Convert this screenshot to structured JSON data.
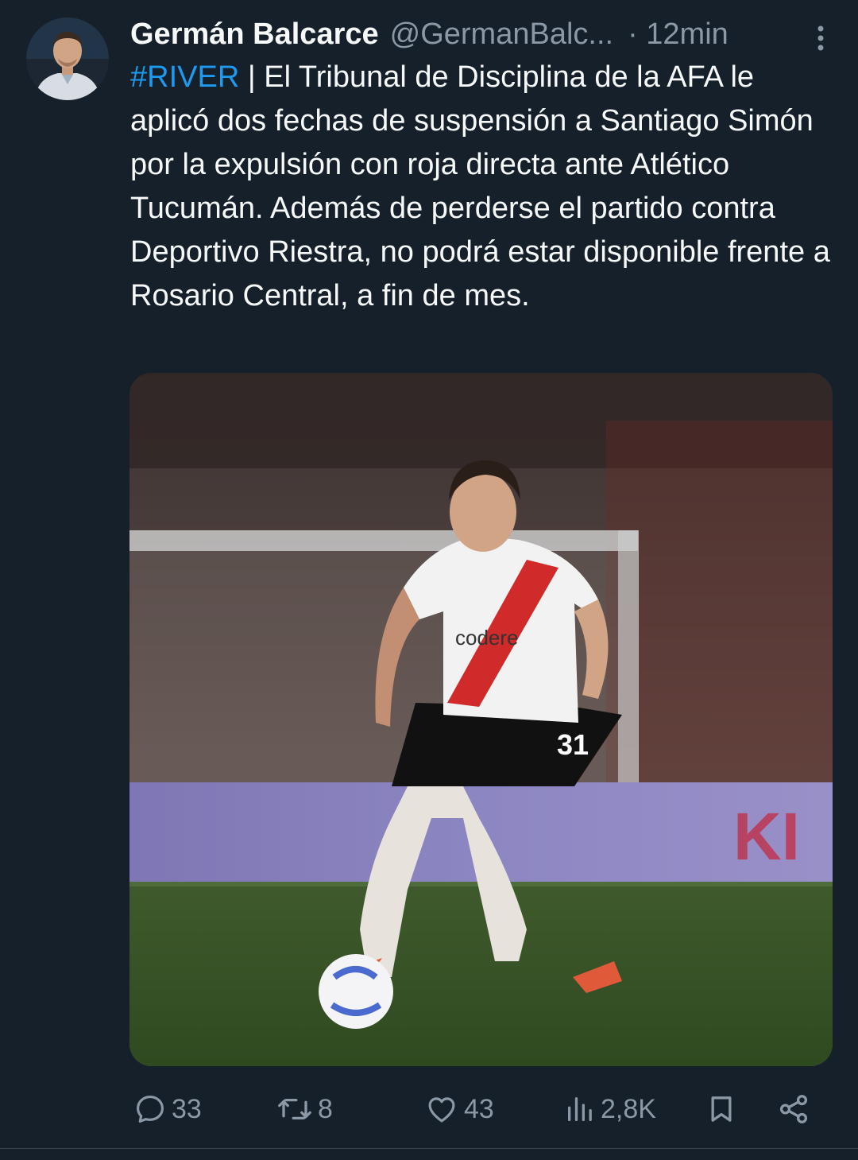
{
  "author": {
    "display_name": "Germán Balcarce",
    "handle": "@GermanBalc...",
    "time": "· 12min"
  },
  "tweet": {
    "hashtag": "#RIVER",
    "body": " | El Tribunal de Disciplina de la AFA le aplicó dos fechas de suspensión a Santiago Simón por la expulsión con roja directa ante Atlético Tucumán. Además de perderse el partido contra Deportivo Riestra, no podrá estar disponible frente a Rosario Central, a fin de mes."
  },
  "media": {
    "jersey_sponsor": "codere",
    "jersey_number": "31",
    "board_text": "KI"
  },
  "actions": {
    "replies": "33",
    "reposts": "8",
    "likes": "43",
    "views": "2,8K"
  },
  "colors": {
    "background": "#15202b",
    "text": "#f7f9f9",
    "muted": "#8b98a5",
    "link": "#1d9bf0"
  },
  "icons": {
    "more": "more-vertical-icon",
    "reply": "reply-icon",
    "repost": "repost-icon",
    "like": "heart-icon",
    "views": "views-icon",
    "bookmark": "bookmark-icon",
    "share": "share-icon"
  }
}
